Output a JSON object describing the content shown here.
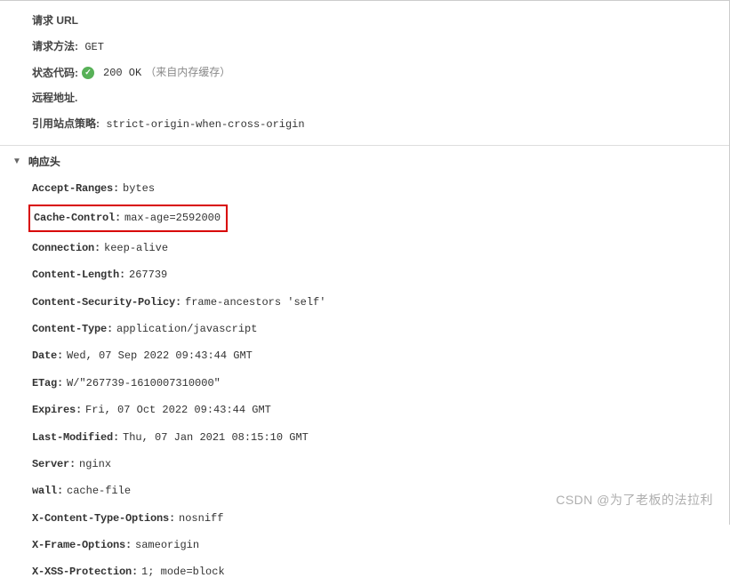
{
  "general": {
    "requestUrl": {
      "label": "请求 URL"
    },
    "requestMethod": {
      "label": "请求方法:",
      "value": "GET"
    },
    "statusCode": {
      "label": "状态代码:",
      "code": "200 OK",
      "hint": "（来自内存缓存）",
      "icon": "✓"
    },
    "remoteAddress": {
      "label": "远程地址."
    },
    "referrerPolicy": {
      "label": "引用站点策略:",
      "value": "strict-origin-when-cross-origin"
    }
  },
  "responseSection": {
    "title": "响应头",
    "triangle": "▼"
  },
  "responseHeaders": [
    {
      "name": "Accept-Ranges:",
      "value": "bytes",
      "highlight": false
    },
    {
      "name": "Cache-Control:",
      "value": "max-age=2592000",
      "highlight": true
    },
    {
      "name": "Connection:",
      "value": "keep-alive",
      "highlight": false
    },
    {
      "name": "Content-Length:",
      "value": "267739",
      "highlight": false
    },
    {
      "name": "Content-Security-Policy:",
      "value": "frame-ancestors 'self'",
      "highlight": false
    },
    {
      "name": "Content-Type:",
      "value": "application/javascript",
      "highlight": false
    },
    {
      "name": "Date:",
      "value": "Wed, 07 Sep 2022 09:43:44 GMT",
      "highlight": false
    },
    {
      "name": "ETag:",
      "value": "W/\"267739-1610007310000\"",
      "highlight": false
    },
    {
      "name": "Expires:",
      "value": "Fri, 07 Oct 2022 09:43:44 GMT",
      "highlight": false
    },
    {
      "name": "Last-Modified:",
      "value": "Thu, 07 Jan 2021 08:15:10 GMT",
      "highlight": false
    },
    {
      "name": "Server:",
      "value": "nginx",
      "highlight": false
    },
    {
      "name": "wall:",
      "value": "cache-file",
      "highlight": false
    },
    {
      "name": "X-Content-Type-Options:",
      "value": "nosniff",
      "highlight": false
    },
    {
      "name": "X-Frame-Options:",
      "value": "sameorigin",
      "highlight": false
    },
    {
      "name": "X-XSS-Protection:",
      "value": "1; mode=block",
      "highlight": false
    }
  ],
  "watermark": "CSDN @为了老板的法拉利"
}
